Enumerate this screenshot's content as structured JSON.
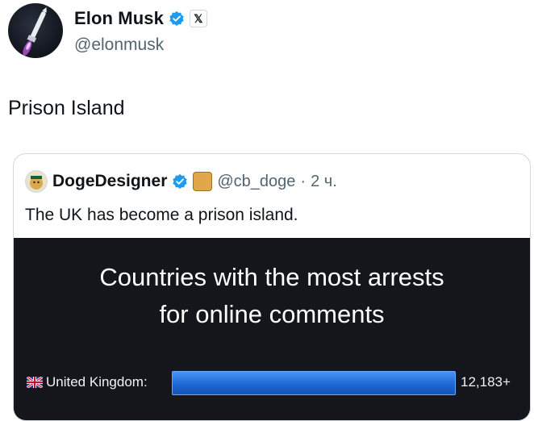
{
  "tweet": {
    "author_name": "Elon Musk",
    "author_handle": "@elonmusk",
    "text": "Prison Island"
  },
  "quote": {
    "author_name": "DogeDesigner",
    "author_handle": "@cb_doge",
    "separator": "·",
    "time": "2 ч.",
    "text": "The UK has become a prison island."
  },
  "chart_data": {
    "type": "bar",
    "title_line1": "Countries with the most arrests",
    "title_line2": "for online comments",
    "categories": [
      "United Kingdom:"
    ],
    "value_labels": [
      "12,183+"
    ],
    "values": [
      12183
    ],
    "bar_color": "#1f6cd8"
  }
}
